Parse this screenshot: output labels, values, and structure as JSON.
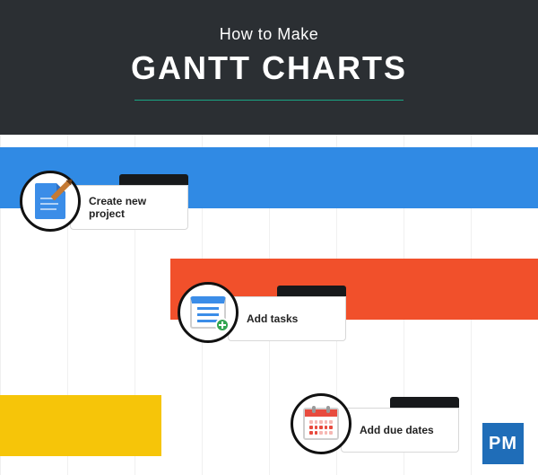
{
  "header": {
    "subtitle": "How to Make",
    "title": "GANTT CHARTS"
  },
  "steps": [
    {
      "label": "Create new project",
      "icon": "document-pencil-icon"
    },
    {
      "label": "Add tasks",
      "icon": "checklist-add-icon"
    },
    {
      "label": "Add due dates",
      "icon": "calendar-icon"
    }
  ],
  "bars": {
    "blue_color": "#308ae4",
    "orange_color": "#f1502b",
    "yellow_color": "#f6c509"
  },
  "logo": {
    "text": "PM"
  }
}
